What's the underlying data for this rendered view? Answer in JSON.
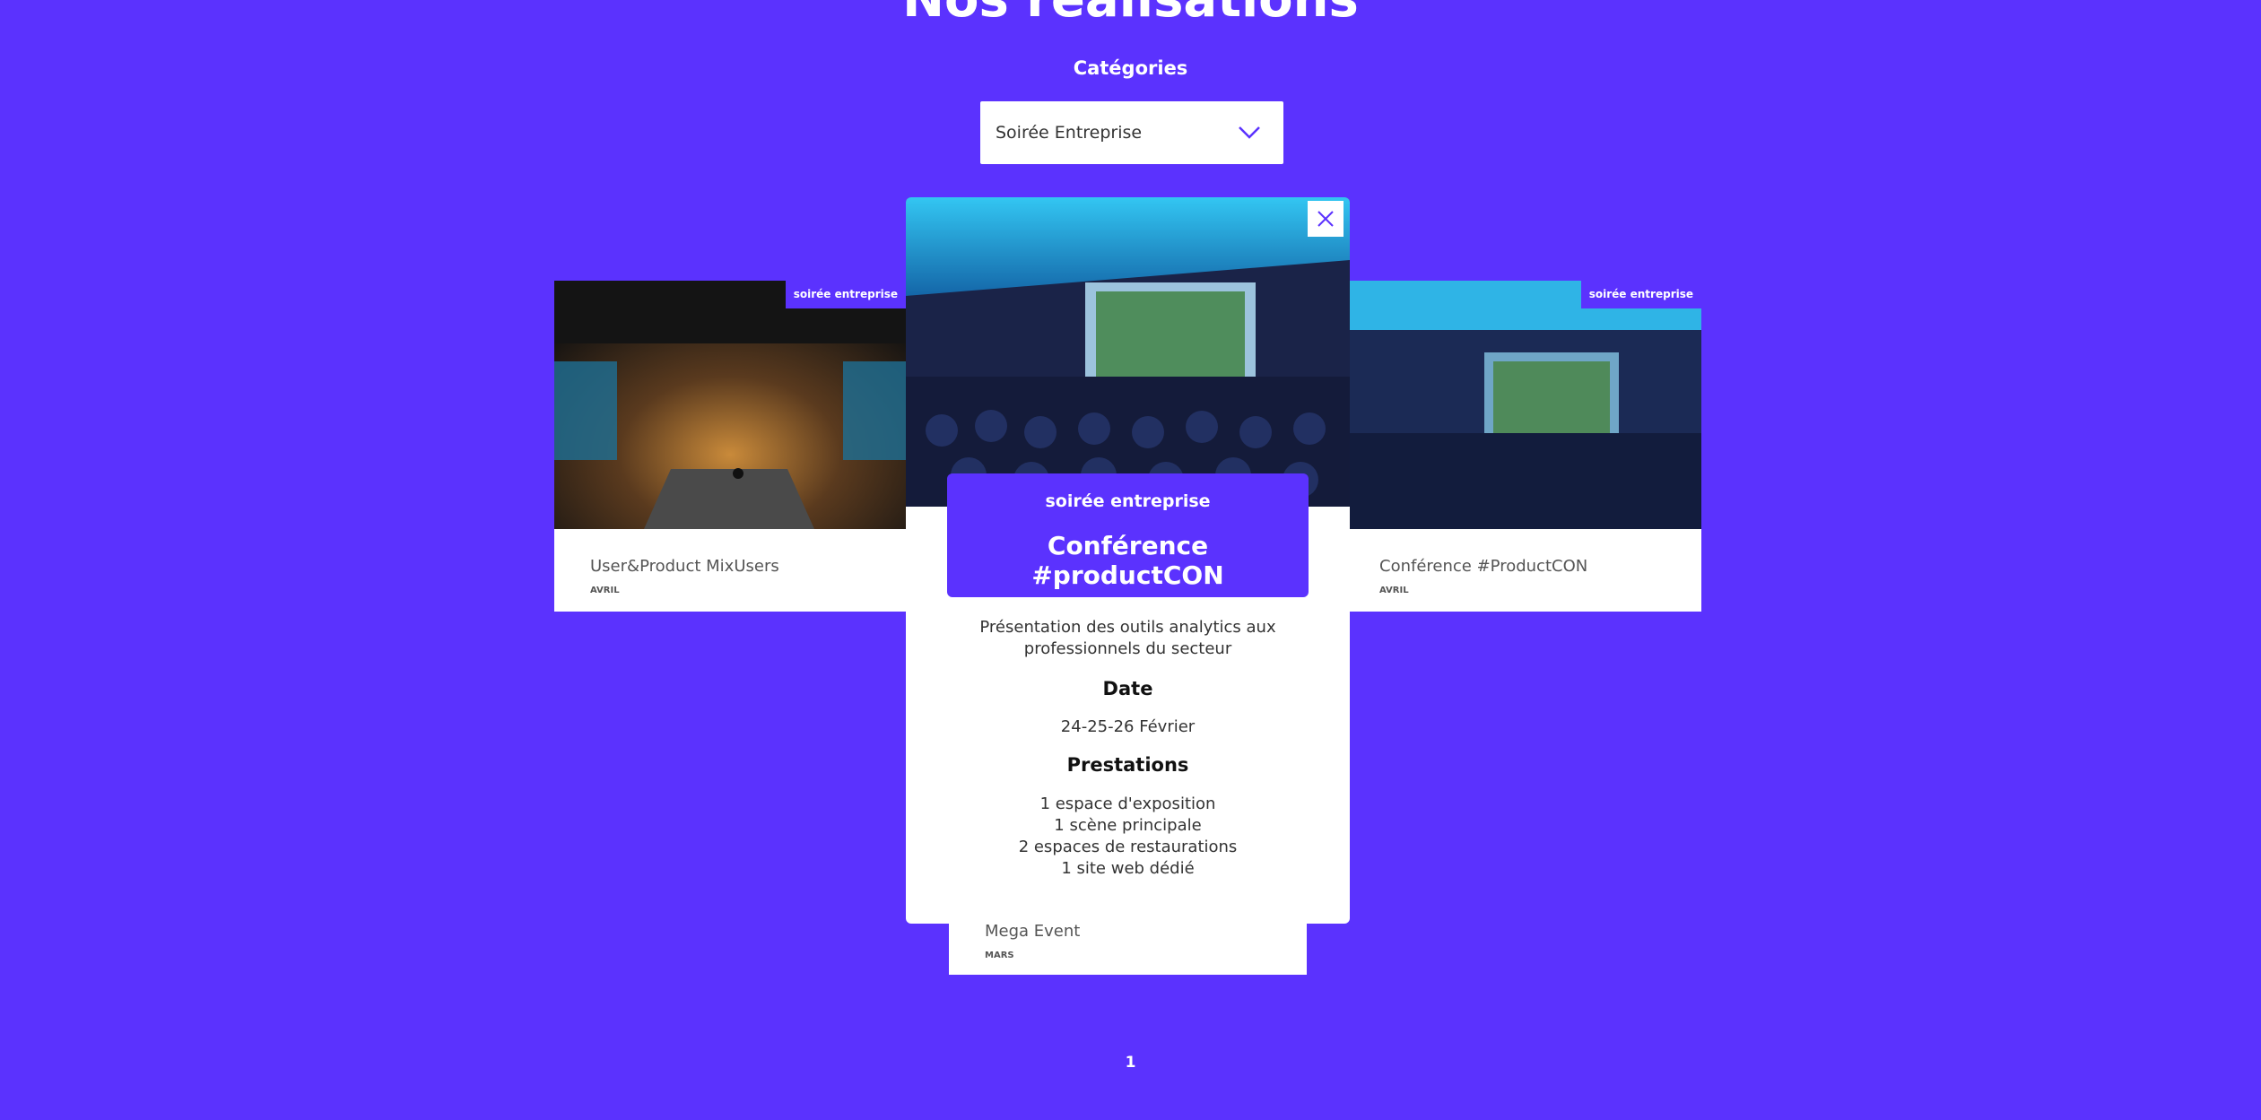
{
  "page": {
    "title": "Nos réalisations"
  },
  "filter": {
    "label": "Catégories",
    "selected": "Soirée Entreprise"
  },
  "cards": [
    {
      "badge": "soirée entreprise",
      "name": "User&Product MixUsers",
      "month": "AVRIL"
    },
    {
      "badge": "soirée entreprise",
      "name": "Conférence #ProductCON",
      "month": "AVRIL"
    },
    {
      "name": "Mega Event",
      "month": "MARS"
    }
  ],
  "modal": {
    "category": "soirée entreprise",
    "title": "Conférence #productCON",
    "description_lines": [
      "Présentation des outils analytics aux",
      "professionnels du secteur"
    ],
    "date_heading": "Date",
    "date": "24-25-26 Février",
    "services_heading": "Prestations",
    "services": [
      "1 espace d'exposition",
      "1 scène principale",
      "2 espaces de restaurations",
      "1 site web dédié"
    ]
  },
  "pagination": {
    "current": "1"
  },
  "colors": {
    "accent": "#5b32fe",
    "white": "#ffffff"
  },
  "icons": {
    "close": "close-icon",
    "chevron": "chevron-down-icon"
  }
}
